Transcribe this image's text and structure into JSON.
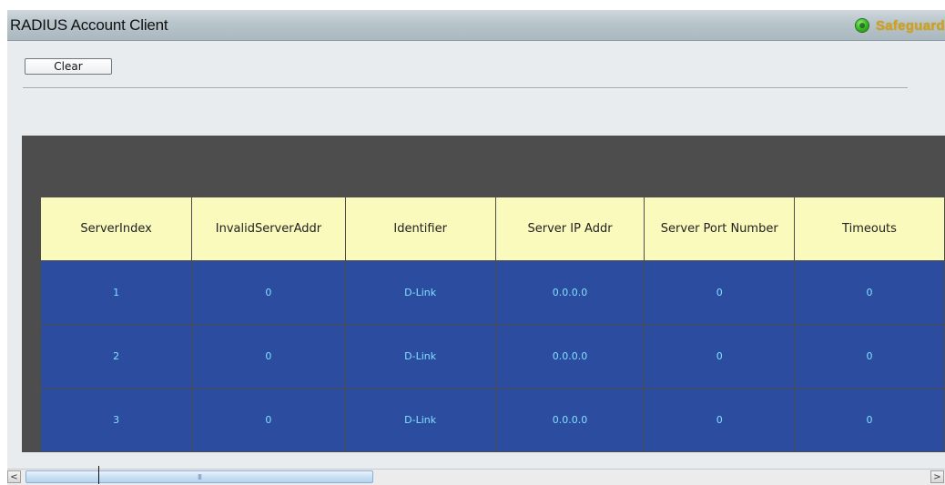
{
  "header": {
    "title": "RADIUS Account Client",
    "safeguard_label": "Safeguard",
    "safeguard_icon": "status-dot-icon"
  },
  "toolbar": {
    "clear_label": "Clear"
  },
  "table": {
    "columns": [
      "ServerIndex",
      "InvalidServerAddr",
      "Identifier",
      "Server IP Addr",
      "Server Port Number",
      "Timeouts"
    ],
    "rows": [
      [
        "1",
        "0",
        "D-Link",
        "0.0.0.0",
        "0",
        "0"
      ],
      [
        "2",
        "0",
        "D-Link",
        "0.0.0.0",
        "0",
        "0"
      ],
      [
        "3",
        "0",
        "D-Link",
        "0.0.0.0",
        "0",
        "0"
      ]
    ]
  },
  "scrollbar": {
    "left_arrow": "<",
    "right_arrow": ">",
    "thumb_grip": "III"
  },
  "colors": {
    "header_row_bg": "#fafabc",
    "data_row_bg": "#2b4c9f",
    "data_text": "#7fe1ff",
    "table_frame": "#4d4d4d",
    "safeguard_text": "#d0a21c"
  }
}
